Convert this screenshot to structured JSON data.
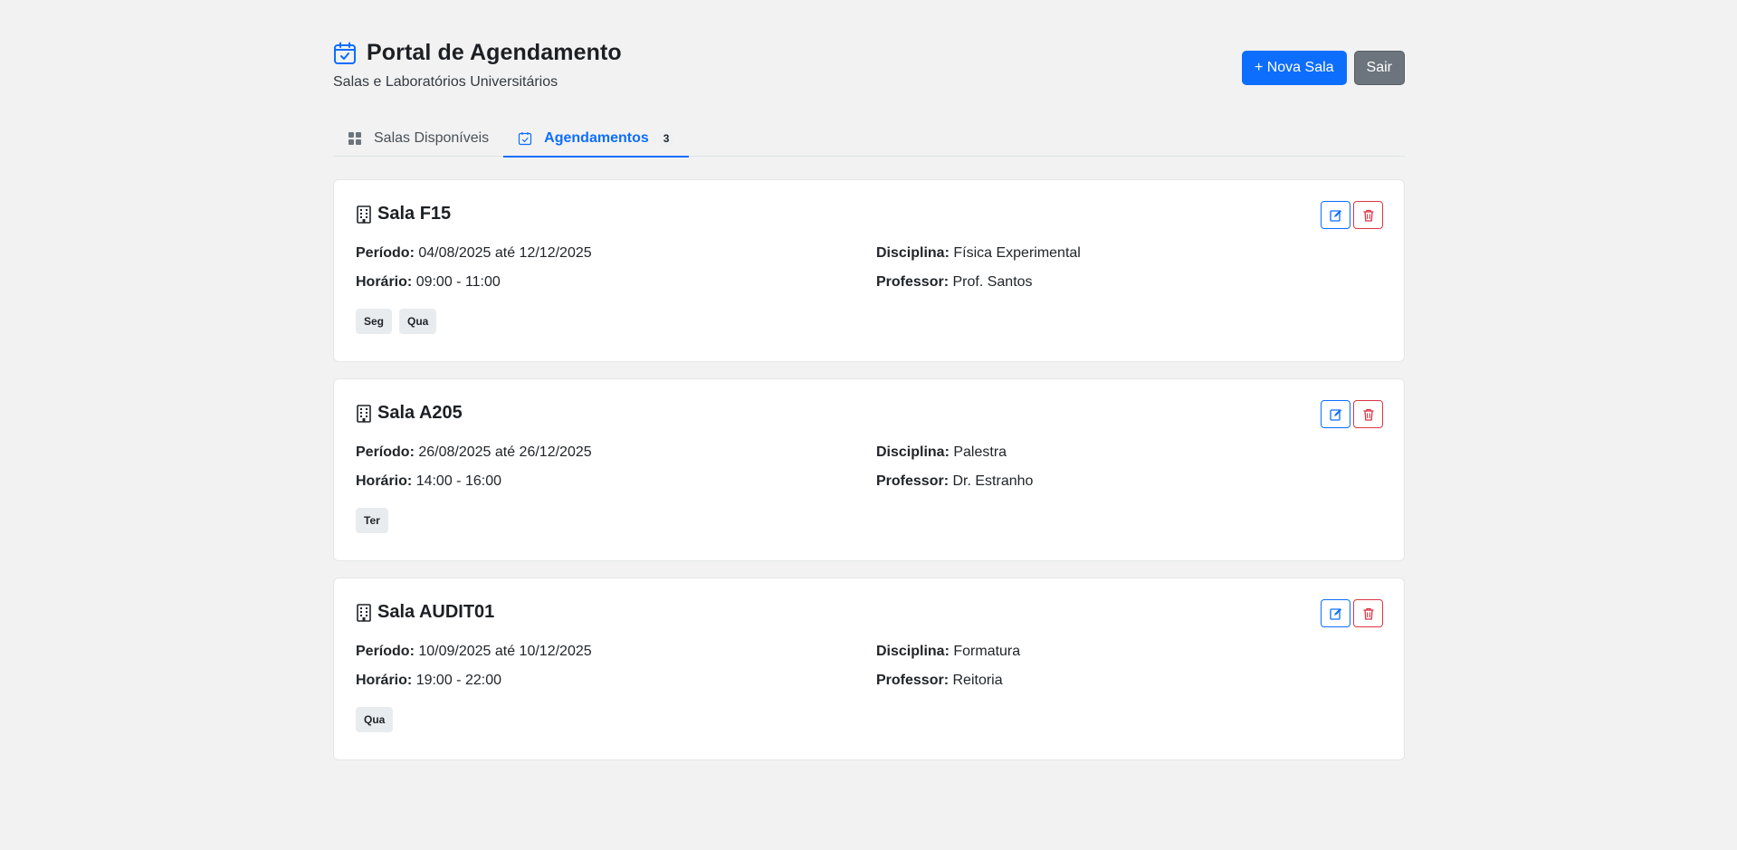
{
  "header": {
    "title": "Portal de Agendamento",
    "subtitle": "Salas e Laboratórios Universitários",
    "new_room_label": "+ Nova Sala",
    "logout_label": "Sair"
  },
  "tabs": [
    {
      "label": "Salas Disponíveis",
      "icon": "grid-icon",
      "active": false
    },
    {
      "label": "Agendamentos",
      "icon": "calendar-check-icon",
      "active": true,
      "badge": "3"
    }
  ],
  "labels": {
    "periodo": "Período:",
    "horario": "Horário:",
    "disciplina": "Disciplina:",
    "professor": "Professor:"
  },
  "bookings": [
    {
      "room": "Sala F15",
      "period": "04/08/2025 até 12/12/2025",
      "time": "09:00 - 11:00",
      "discipline": "Física Experimental",
      "professor": "Prof. Santos",
      "days": [
        "Seg",
        "Qua"
      ]
    },
    {
      "room": "Sala A205",
      "period": "26/08/2025 até 26/12/2025",
      "time": "14:00 - 16:00",
      "discipline": "Palestra",
      "professor": "Dr. Estranho",
      "days": [
        "Ter"
      ]
    },
    {
      "room": "Sala AUDIT01",
      "period": "10/09/2025 até 10/12/2025",
      "time": "19:00 - 22:00",
      "discipline": "Formatura",
      "professor": "Reitoria",
      "days": [
        "Qua"
      ]
    }
  ],
  "colors": {
    "primary": "#0d6efd",
    "secondary": "#6c757d",
    "danger": "#dc3545",
    "background": "#f2f2f2"
  }
}
